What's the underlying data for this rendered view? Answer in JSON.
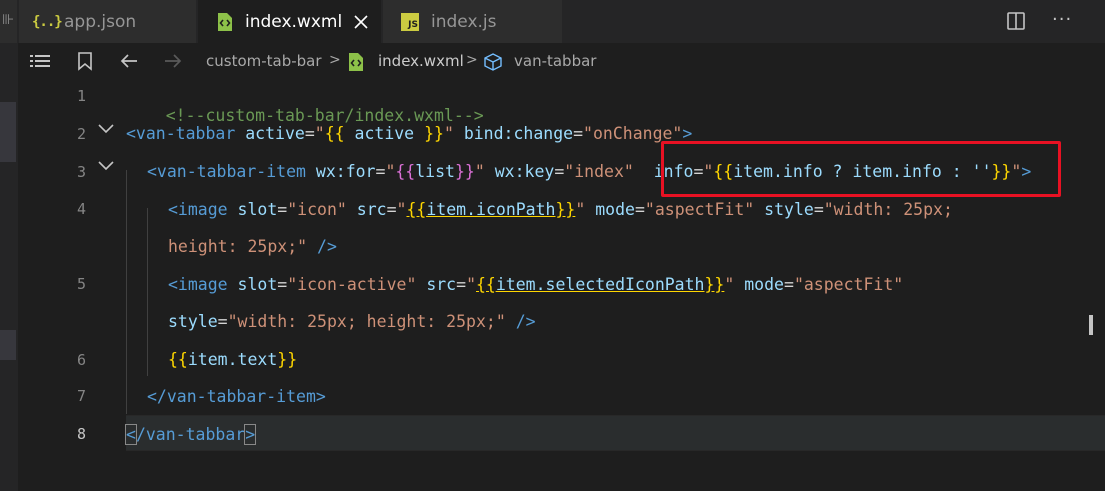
{
  "tabs": {
    "overflow_glyph": "⊪",
    "items": [
      {
        "label": "app.json",
        "icon": "json-braces-icon",
        "icon_text": "{..}",
        "active": false
      },
      {
        "label": "index.wxml",
        "icon": "wxml-file-icon",
        "active": true
      },
      {
        "label": "index.js",
        "icon": "js-file-icon",
        "icon_text": "JS",
        "active": false
      }
    ],
    "more_actions": "···"
  },
  "breadcrumb": {
    "folder": "custom-tab-bar",
    "file": "index.wxml",
    "symbol": "van-tabbar"
  },
  "editor": {
    "line_numbers": [
      "1",
      "2",
      "3",
      "4",
      "5",
      "6",
      "7",
      "8"
    ],
    "current_line": "8",
    "lines": {
      "l1": "<!--custom-tab-bar/index.wxml-->",
      "l2": {
        "tag_open": "<van-tabbar",
        "a1": "active",
        "eq1": "=",
        "q1": "\"",
        "b1o": "{{",
        "v1": " active ",
        "b1c": "}}",
        "q2": "\"",
        "a2": "bind:change",
        "eq2": "=",
        "v2": "\"onChange\"",
        "close": ">"
      },
      "l3": {
        "tag_open": "<van-tabbar-item",
        "a1": "wx:for",
        "eq1": "=",
        "q1": "\"",
        "b1o": "{{",
        "v1": "list",
        "b1c": "}}",
        "q2": "\"",
        "a2": "wx:key",
        "eq2": "=",
        "v2": "\"index\"",
        "a3": "info",
        "eq3": "=",
        "q3": "\"",
        "b3o": "{{",
        "v3": "item.info ? item.info : ''",
        "b3c": "}}",
        "q4": "\"",
        "close": ">"
      },
      "l4a": {
        "tag_open": "<image",
        "a1": "slot",
        "eq1": "=",
        "v1": "\"icon\"",
        "a2": "src",
        "eq2": "=",
        "q1": "\"",
        "b1o": "{{",
        "v2": "item.iconPath",
        "b1c": "}}",
        "q2": "\"",
        "a3": "mode",
        "eq3": "=",
        "v3": "\"aspectFit\"",
        "a4": "style",
        "eq4": "=",
        "v4a": "\"width: 25px;"
      },
      "l4b": {
        "v4b": "height: 25px;\"",
        "close": " />"
      },
      "l5a": {
        "tag_open": "<image",
        "a1": "slot",
        "eq1": "=",
        "v1": "\"icon-active\"",
        "a2": "src",
        "eq2": "=",
        "q1": "\"",
        "b1o": "{{",
        "v2": "item.selectedIconPath",
        "b1c": "}}",
        "q2": "\"",
        "a3": "mode",
        "eq3": "=",
        "v3": "\"aspectFit\""
      },
      "l5b": {
        "a4": "style",
        "eq4": "=",
        "v4": "\"width: 25px; height: 25px;\"",
        "close": " />"
      },
      "l6": {
        "b1o": "{{",
        "v1": "item.text",
        "b1c": "}}"
      },
      "l7": "</van-tabbar-item>",
      "l8": {
        "open": "<",
        "tag": "/van-tabbar",
        "close": ">"
      }
    }
  },
  "colors": {
    "highlight_box": "#e81123",
    "tag": "#569cd6",
    "attribute": "#9cdcfe",
    "string": "#ce9178",
    "comment": "#6a9955",
    "bracket_gold": "#ffd700"
  }
}
